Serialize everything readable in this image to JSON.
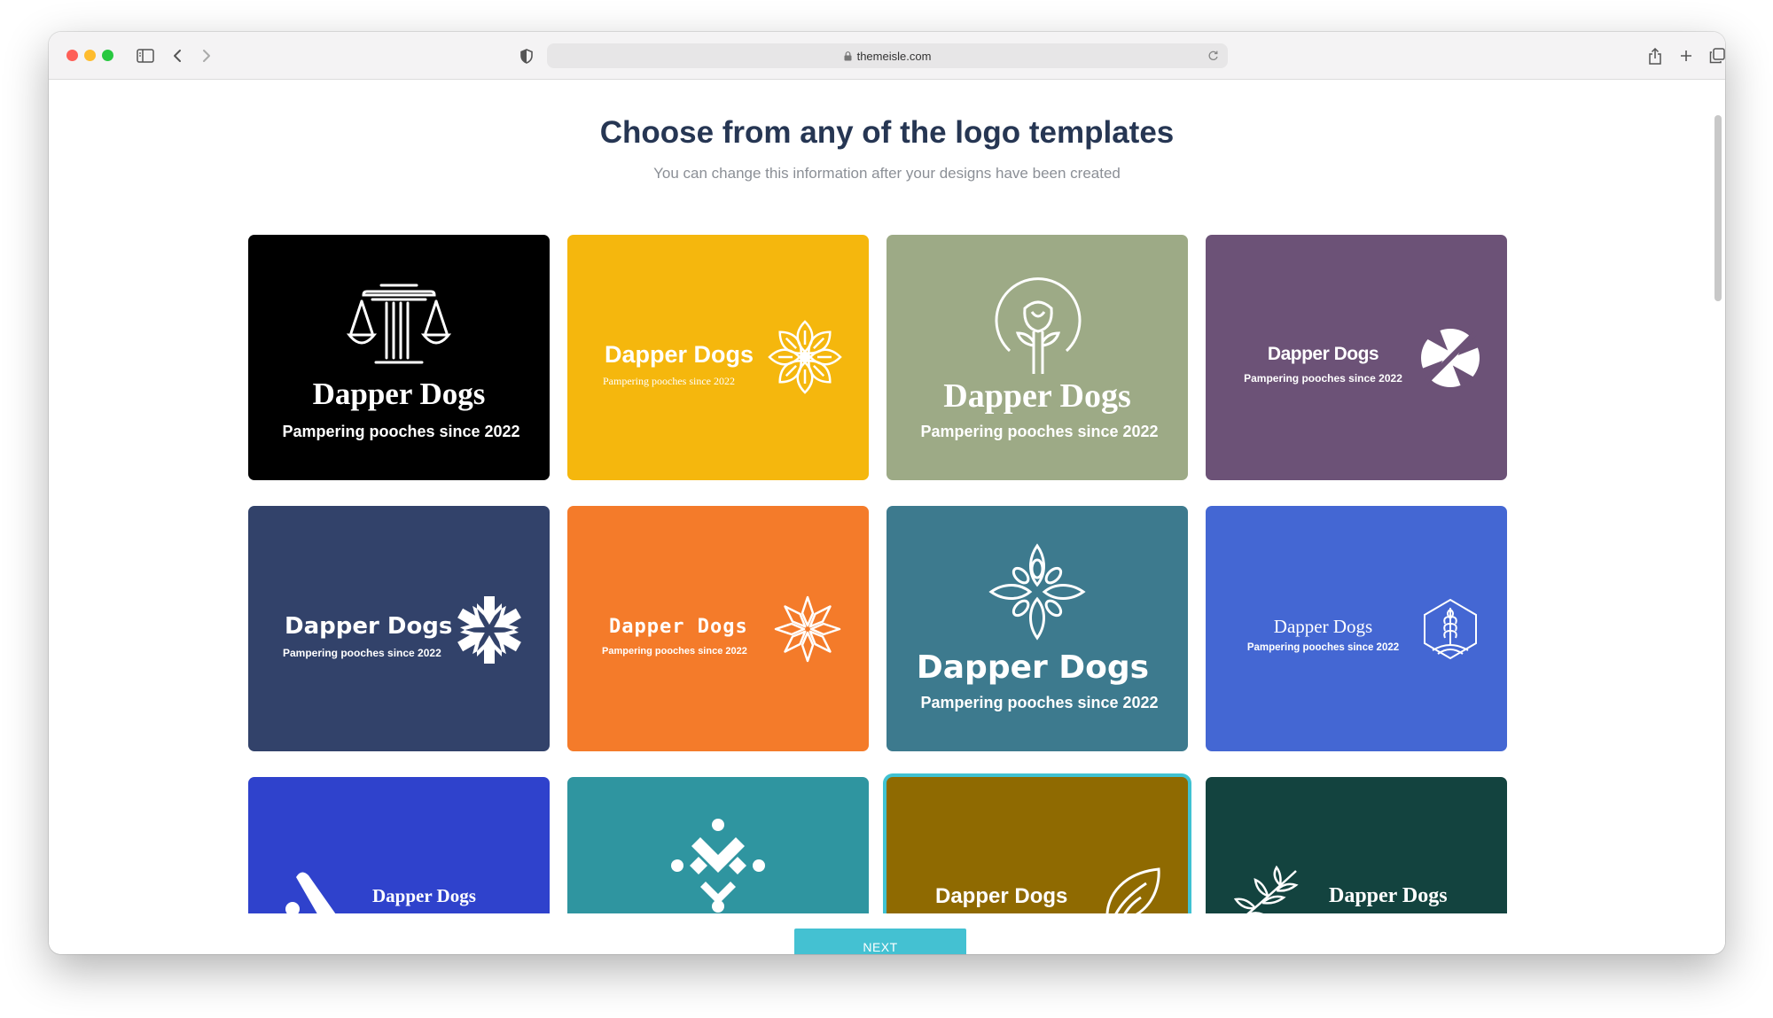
{
  "browser": {
    "url": "themeisle.com"
  },
  "page": {
    "title": "Choose from any of the logo templates",
    "subtitle": "You can change this information after your designs have been created",
    "next_label": "NEXT"
  },
  "logo_cards": [
    {
      "name": "Dapper Dogs",
      "tagline": "Pampering pooches since 2022",
      "bg": "#000000",
      "icon": "scales-of-justice-icon"
    },
    {
      "name": "Dapper Dogs",
      "tagline": "Pampering pooches since 2022",
      "bg": "#f5b70d",
      "icon": "leaf-mandala-icon"
    },
    {
      "name": "Dapper Dogs",
      "tagline": "Pampering pooches since 2022",
      "bg": "#9daa86",
      "icon": "rose-circle-icon"
    },
    {
      "name": "Dapper Dogs",
      "tagline": "Pampering pooches since 2022",
      "bg": "#6c5277",
      "icon": "x-circle-icon"
    },
    {
      "name": "Dapper Dogs",
      "tagline": "Pampering pooches since 2022",
      "bg": "#32426a",
      "icon": "snowflake-icon"
    },
    {
      "name": "Dapper Dogs",
      "tagline": "Pampering pooches since 2022",
      "bg": "#f47b2a",
      "icon": "starburst-icon"
    },
    {
      "name": "Dapper Dogs",
      "tagline": "Pampering pooches since 2022",
      "bg": "#3d7a8e",
      "icon": "diamond-leaves-icon"
    },
    {
      "name": "Dapper Dogs",
      "tagline": "Pampering pooches since 2022",
      "bg": "#4467d3",
      "icon": "wheat-hexagon-icon"
    },
    {
      "name": "Dapper Dogs",
      "tagline": "",
      "bg": "#2f42cc",
      "icon": "slash-icon"
    },
    {
      "name": "",
      "tagline": "",
      "bg": "#2f95a0",
      "icon": "dotted-chevron-icon"
    },
    {
      "name": "Dapper Dogs",
      "tagline": "",
      "bg": "#8f6a01",
      "icon": "leaf-outline-icon",
      "selected": true
    },
    {
      "name": "Dapper Dogs",
      "tagline": "",
      "bg": "#13433f",
      "icon": "branch-icon"
    }
  ]
}
